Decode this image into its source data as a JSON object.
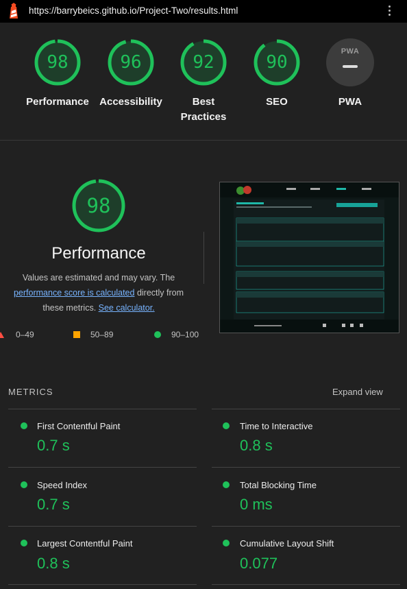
{
  "browser": {
    "url": "https://barrybeics.github.io/Project-Two/results.html"
  },
  "colors": {
    "pass": "#1fc15a",
    "average": "#ffa400",
    "fail": "#ff4e42",
    "link": "#78b4ff",
    "background": "#212121"
  },
  "scores": [
    {
      "label": "Performance",
      "value": "98",
      "fraction": 0.98
    },
    {
      "label": "Accessibility",
      "value": "96",
      "fraction": 0.96
    },
    {
      "label_line1": "Best",
      "label_line2": "Practices",
      "value": "92",
      "fraction": 0.92
    },
    {
      "label": "SEO",
      "value": "90",
      "fraction": 0.9
    }
  ],
  "pwa": {
    "label": "PWA",
    "badge_text": "PWA"
  },
  "performance": {
    "score": "98",
    "fraction": 0.98,
    "title": "Performance",
    "desc_before": "Values are estimated and may vary. The ",
    "desc_link": "performance score is calculated",
    "desc_middle": " directly from these metrics. ",
    "desc_calc": "See calculator."
  },
  "legend": {
    "fail": "0–49",
    "average": "50–89",
    "pass": "90–100"
  },
  "metrics": {
    "heading": "METRICS",
    "expand": "Expand view",
    "items": [
      {
        "title": "First Contentful Paint",
        "value": "0.7 s"
      },
      {
        "title": "Time to Interactive",
        "value": "0.8 s"
      },
      {
        "title": "Speed Index",
        "value": "0.7 s"
      },
      {
        "title": "Total Blocking Time",
        "value": "0 ms"
      },
      {
        "title": "Largest Contentful Paint",
        "value": "0.8 s"
      },
      {
        "title": "Cumulative Layout Shift",
        "value": "0.077"
      }
    ]
  }
}
